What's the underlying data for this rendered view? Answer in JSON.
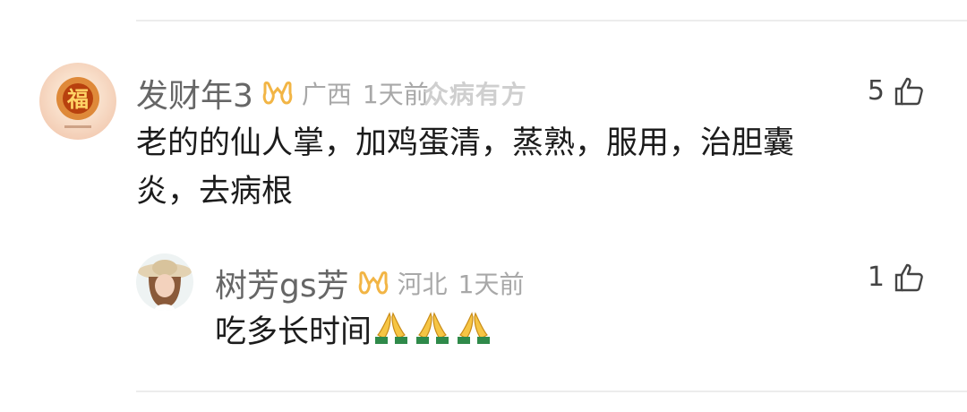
{
  "comments": [
    {
      "username": "发财年3",
      "location": "广西",
      "time": "1天前",
      "watermark": "众病有方",
      "likes": "5",
      "text_line1": "老的的仙人掌，加鸡蛋清，蒸熟，服用，治胆囊",
      "text_line2": "炎，去病根",
      "avatar_icon": "fu-character-avatar",
      "badge_icon": "vip-badge-icon"
    },
    {
      "username": "树芳gs芳",
      "location": "河北",
      "time": "1天前",
      "likes": "1",
      "text": "吃多长时间",
      "emoji": [
        "pray-emoji",
        "pray-emoji",
        "pray-emoji"
      ],
      "avatar_icon": "woman-with-hat-avatar",
      "badge_icon": "vip-badge-icon"
    }
  ],
  "colors": {
    "username": "#666666",
    "meta": "#a8a8a8",
    "text": "#1c1c1c",
    "badge": "#f2b545"
  }
}
